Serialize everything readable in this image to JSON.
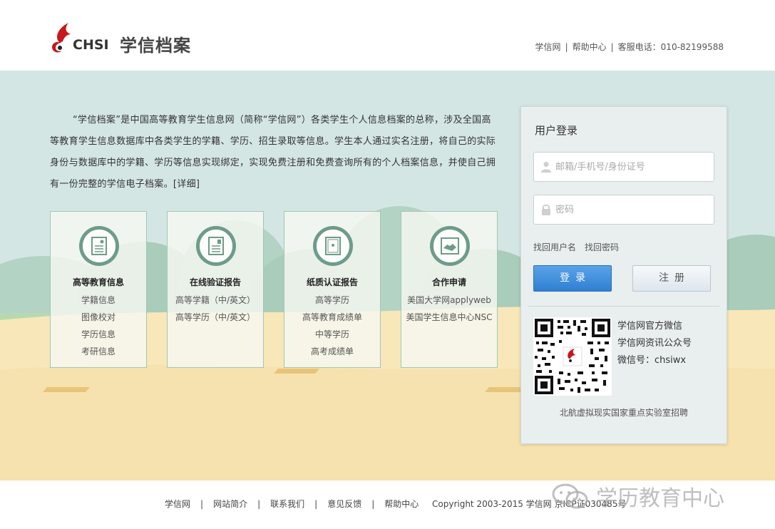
{
  "header": {
    "logo_text": "CHSI",
    "title": "学信档案",
    "links": [
      {
        "label": "学信网"
      },
      {
        "label": "帮助中心"
      }
    ],
    "hotline": "客服电话：010-82199588",
    "separator": "|"
  },
  "intro": {
    "text": "“学信档案”是中国高等教育学生信息网（简称“学信网”）各类学生个人信息档案的总称，涉及全国高等教育学生信息数据库中各类学生的学籍、学历、招生录取等信息。学生本人通过实名注册，将自己的实际身份与数据库中的学籍、学历等信息实现绑定，实现免费注册和免费查询所有的个人档案信息，并使自己拥有一份完整的学信电子档案。",
    "more_link": "[详细]"
  },
  "cards": [
    {
      "title": "高等教育信息",
      "icon": "student-file-icon",
      "links": [
        "学籍信息",
        "图像校对",
        "学历信息",
        "考研信息"
      ]
    },
    {
      "title": "在线验证报告",
      "icon": "online-report-icon",
      "links": [
        "高等学籍（中/英文）",
        "高等学历（中/英文）"
      ]
    },
    {
      "title": "纸质认证报告",
      "icon": "paper-certificate-icon",
      "links": [
        "高等学历",
        "高等教育成绩单",
        "中等学历",
        "高考成绩单"
      ]
    },
    {
      "title": "合作申请",
      "icon": "handshake-icon",
      "links": [
        "美国大学网applyweb",
        "美国学生信息中心NSC"
      ]
    }
  ],
  "login": {
    "title": "用户登录",
    "username_placeholder": "邮箱/手机号/身份证号",
    "username_value": "",
    "password_placeholder": "密码",
    "password_value": "",
    "find_username": "找回用户名",
    "find_password": "找回密码",
    "login_button": "登录",
    "register_button": "注册",
    "wechat_lines": [
      "学信网官方微信",
      "学信网资讯公众号",
      "微信号：chsiwx"
    ],
    "footer_text": "北航虚拟现实国家重点实验室招聘"
  },
  "footer": {
    "links": [
      "学信网",
      "网站简介",
      "联系我们",
      "意见反馈",
      "帮助中心"
    ],
    "separator": "|",
    "copyright": "Copyright 2003-2015 学信网 京ICP证030485号"
  },
  "watermark": {
    "text": "学历教育中心"
  },
  "colors": {
    "band_bg": "#d4e6e4",
    "sand": "#f8e7b8",
    "grass": "#b8d9b0",
    "tree": "#a9ccbb",
    "card_border": "#9fc8b4",
    "icon_green": "#6d9c8a",
    "login_button": "#3388dd",
    "logo_red": "#c8161d"
  }
}
